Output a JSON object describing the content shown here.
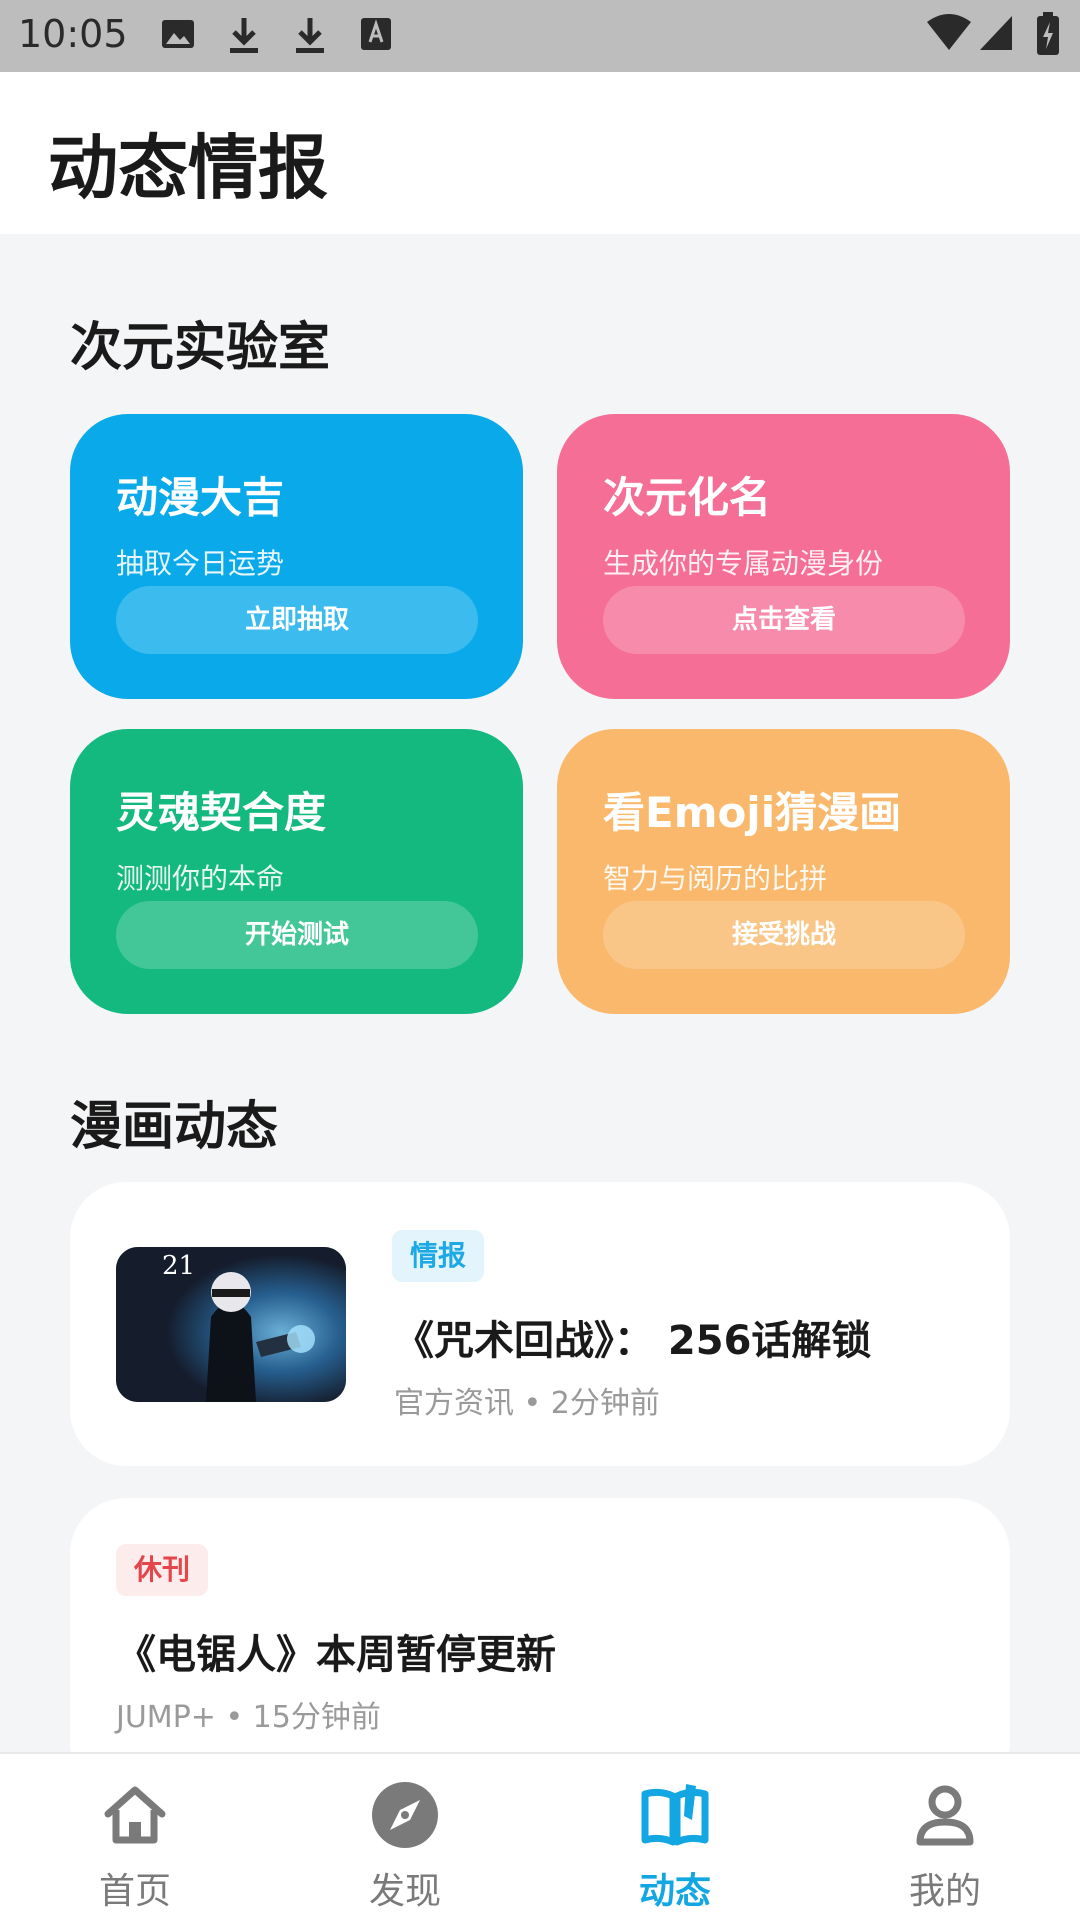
{
  "status_bar": {
    "time": "10:05"
  },
  "header": {
    "title": "动态情报"
  },
  "lab": {
    "section_title": "次元实验室",
    "cards": [
      {
        "title": "动漫大吉",
        "subtitle": "抽取今日运势",
        "button": "立即抽取",
        "color": "#0aaaea"
      },
      {
        "title": "次元化名",
        "subtitle": "生成你的专属动漫身份",
        "button": "点击查看",
        "color": "#f56e96"
      },
      {
        "title": "灵魂契合度",
        "subtitle": "测测你的本命",
        "button": "开始测试",
        "color": "#14b97f"
      },
      {
        "title": "看Emoji猜漫画",
        "subtitle": "智力与阅历的比拼",
        "button": "接受挑战",
        "color": "#f9b86b"
      }
    ]
  },
  "news": {
    "section_title": "漫画动态",
    "items": [
      {
        "tag": "情报",
        "tag_color": "#1da9e6",
        "tag_bg": "#e3f4fc",
        "title": "《咒术回战》： 256话解锁",
        "meta": "官方资讯 • 2分钟前",
        "thumb_text": "21"
      },
      {
        "tag": "休刊",
        "tag_color": "#e4464c",
        "tag_bg": "#fdecec",
        "title": "《电锯人》本周暂停更新",
        "meta": "JUMP+ • 15分钟前"
      }
    ]
  },
  "bottom_nav": {
    "items": [
      {
        "label": "首页",
        "icon": "home-icon",
        "active": false
      },
      {
        "label": "发现",
        "icon": "compass-icon",
        "active": false
      },
      {
        "label": "动态",
        "icon": "book-icon",
        "active": true
      },
      {
        "label": "我的",
        "icon": "user-icon",
        "active": false
      }
    ]
  },
  "colors": {
    "accent": "#12a6e3",
    "background": "#f4f5f7"
  }
}
